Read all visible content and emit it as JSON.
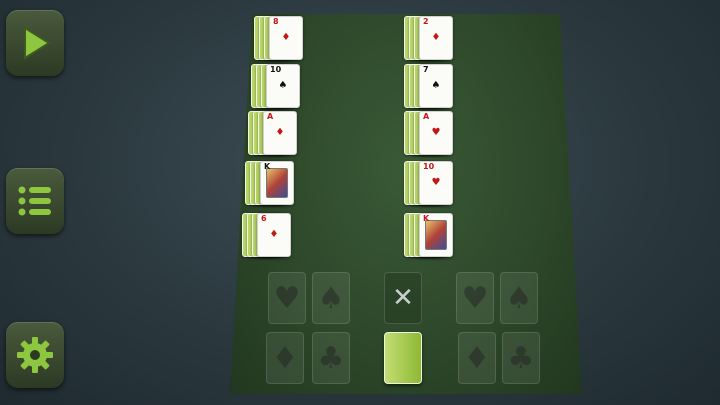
{
  "sidebar": {
    "buttons": [
      {
        "name": "play",
        "icon": "play-icon"
      },
      {
        "name": "menu",
        "icon": "menu-list-icon"
      },
      {
        "name": "settings",
        "icon": "gear-icon"
      }
    ],
    "accent_color": "#8dc63f"
  },
  "tableau": {
    "left_column": [
      {
        "rank": "8",
        "suit": "♦",
        "color": "red"
      },
      {
        "rank": "10",
        "suit": "♠",
        "color": "black"
      },
      {
        "rank": "A",
        "suit": "♦",
        "color": "red"
      },
      {
        "rank": "K",
        "suit": "♠",
        "color": "black"
      },
      {
        "rank": "6",
        "suit": "♦",
        "color": "red"
      }
    ],
    "right_column": [
      {
        "rank": "2",
        "suit": "♦",
        "color": "red"
      },
      {
        "rank": "7",
        "suit": "♠",
        "color": "black"
      },
      {
        "rank": "A",
        "suit": "♥",
        "color": "red"
      },
      {
        "rank": "10",
        "suit": "♥",
        "color": "red"
      },
      {
        "rank": "K",
        "suit": "♦",
        "color": "red"
      }
    ]
  },
  "foundations": {
    "left": [
      "♥",
      "♠",
      "♦",
      "♣"
    ],
    "right": [
      "♥",
      "♠",
      "♦",
      "♣"
    ]
  },
  "stock": {
    "empty_symbol": "✕"
  }
}
